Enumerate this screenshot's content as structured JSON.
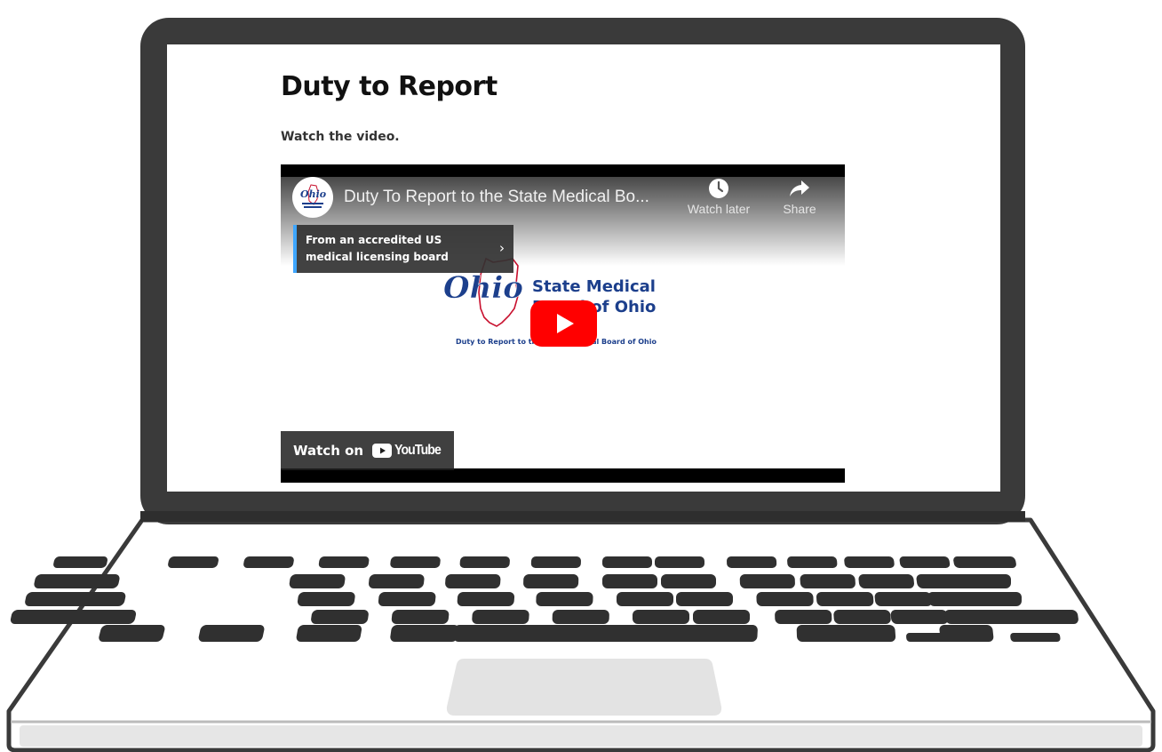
{
  "page": {
    "title": "Duty to Report",
    "intro": "Watch the video."
  },
  "video": {
    "title": "Duty To Report to the State Medical Bo...",
    "actions": {
      "watch_later": "Watch later",
      "share": "Share"
    },
    "info_panel": {
      "text": "From an accredited US medical licensing board",
      "chevron": "›"
    },
    "thumbnail": {
      "logo_wordmark": "Ohio",
      "org_name_line1": "State Medical",
      "org_name_line2": "Board of Ohio",
      "caption": "Duty to Report to the State Medical Board of Ohio"
    },
    "watch_on": {
      "label": "Watch on",
      "brand": "YouTube"
    }
  },
  "colors": {
    "accent_blue": "#3ea6ff",
    "youtube_red": "#ff0000",
    "ohio_blue": "#1c3f8c",
    "ohio_red": "#c8102e",
    "laptop_bezel": "#3a3a3a"
  },
  "icons": {
    "watch_later": "clock-icon",
    "share": "share-arrow-icon",
    "info_chevron": "chevron-right-icon",
    "play": "play-icon",
    "youtube": "youtube-logo-icon"
  }
}
